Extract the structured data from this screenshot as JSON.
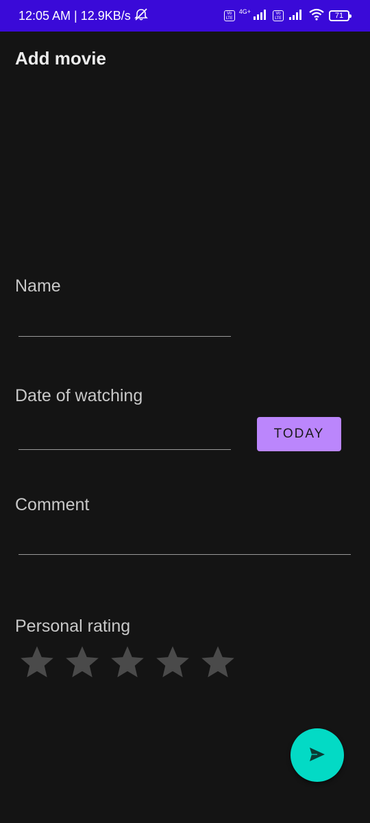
{
  "status_bar": {
    "time_speed": "12:05 AM | 12.9KB/s",
    "network_label": "4G+",
    "lte_badge_1": "Vo LTE",
    "lte_badge_2": "Vo LTE",
    "battery": "71",
    "color": "#3a0ad8"
  },
  "app": {
    "title": "Add movie"
  },
  "form": {
    "name": {
      "label": "Name",
      "value": ""
    },
    "date": {
      "label": "Date of watching",
      "value": "",
      "today_button": "TODAY"
    },
    "comment": {
      "label": "Comment",
      "value": ""
    },
    "rating": {
      "label": "Personal rating",
      "max_stars": 5,
      "value": 0
    }
  },
  "fab": {
    "icon": "send-icon",
    "color": "#03dac5"
  },
  "colors": {
    "background": "#141414",
    "accent": "#bb86fc",
    "star_inactive": "#4a4a4a"
  }
}
